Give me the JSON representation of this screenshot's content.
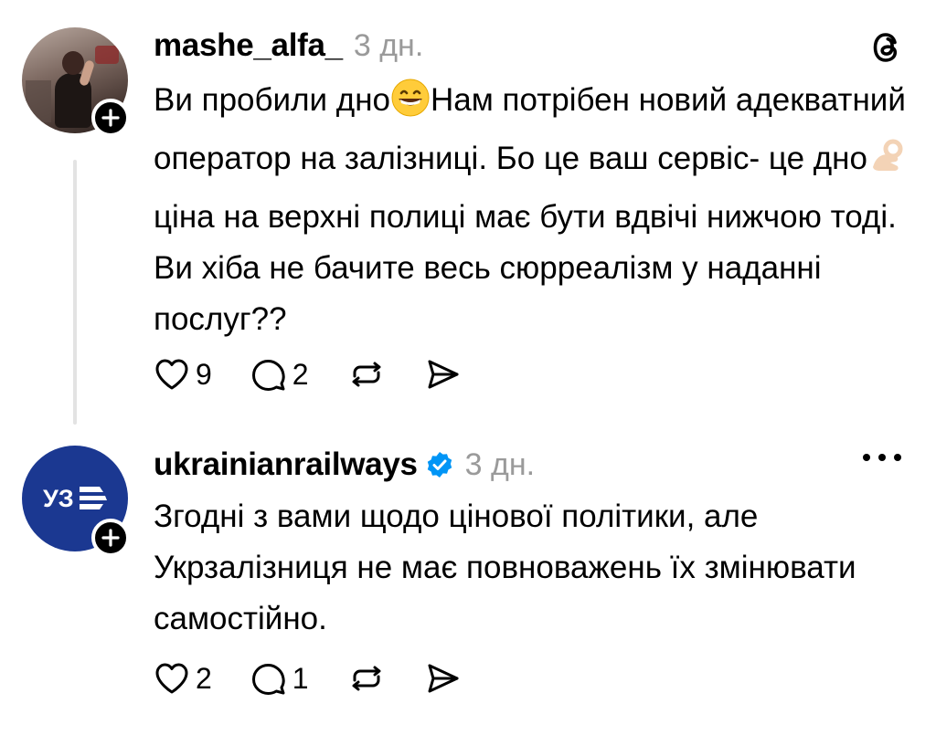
{
  "posts": [
    {
      "username": "mashe_alfa_",
      "time": "3 дн.",
      "verified": false,
      "corner_icon": "threads-logo-icon",
      "avatar_icon": "user-photo-avatar",
      "text_parts": [
        "Ви пробили дно",
        "Нам потрібен новий адекватний оператор на залізниці. Бо це ваш сервіс- це дно",
        " ціна на верхні полиці має бути вдвічі нижчою тоді. Ви хіба не бачите весь сюрреалізм у наданні послуг??"
      ],
      "emojis": [
        "grinning-face-emoji",
        "ok-hand-emoji"
      ],
      "likes": "9",
      "replies": "2"
    },
    {
      "username": "ukrainianrailways",
      "time": "3 дн.",
      "verified": true,
      "corner_icon": "more-options-icon",
      "avatar_icon": "uz-logo",
      "avatar_color": "#1b3891",
      "text": "Згодні з вами щодо цінової політики, але Укрзалізниця не має повноважень їх змінювати самостійно.",
      "likes": "2",
      "replies": "1"
    }
  ],
  "colors": {
    "verified_badge": "#0095f6",
    "secondary_text": "#9a9a9a",
    "thread_line": "#e3e3e3"
  }
}
